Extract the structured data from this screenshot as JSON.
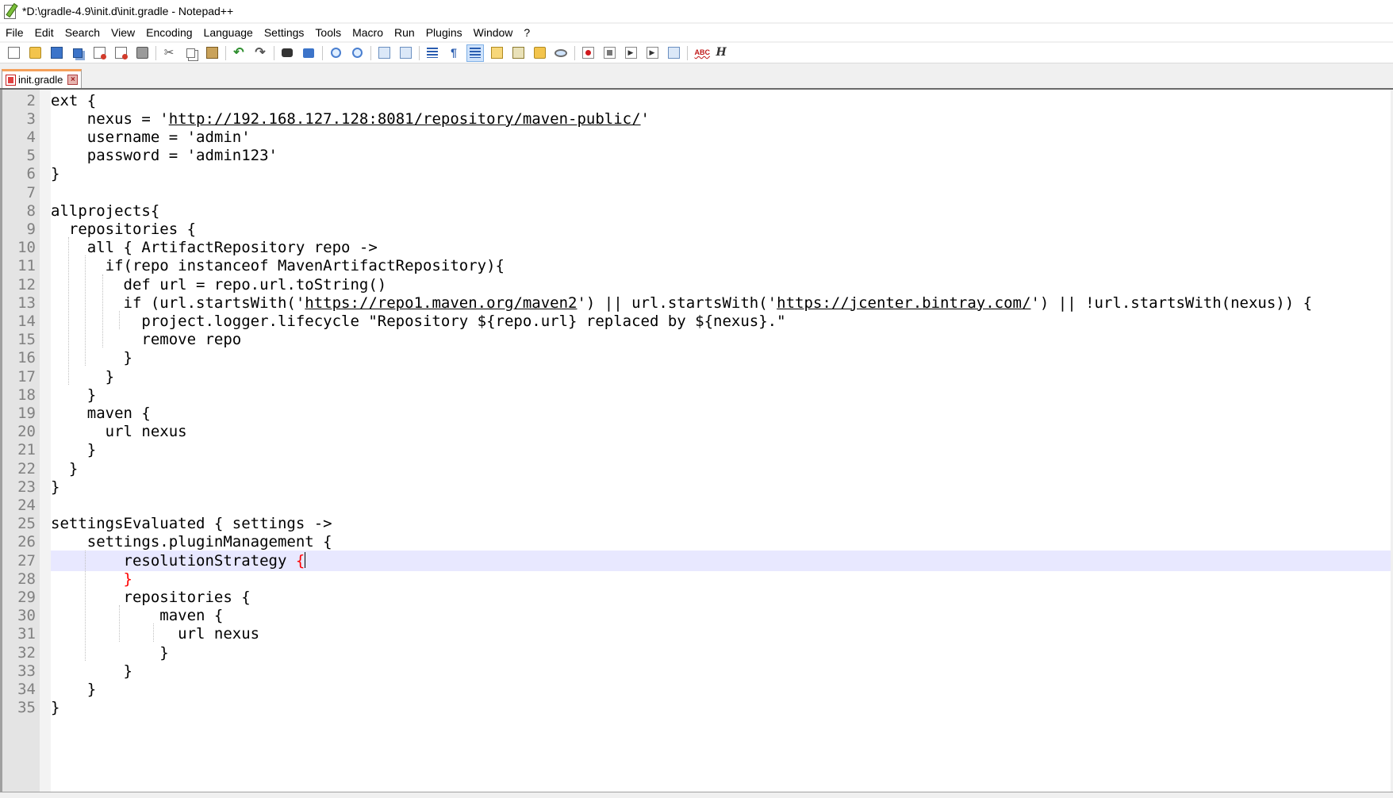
{
  "window": {
    "title": "*D:\\gradle-4.9\\init.d\\init.gradle - Notepad++"
  },
  "menu": [
    {
      "label": "File"
    },
    {
      "label": "Edit"
    },
    {
      "label": "Search"
    },
    {
      "label": "View"
    },
    {
      "label": "Encoding"
    },
    {
      "label": "Language"
    },
    {
      "label": "Settings"
    },
    {
      "label": "Tools"
    },
    {
      "label": "Macro"
    },
    {
      "label": "Run"
    },
    {
      "label": "Plugins"
    },
    {
      "label": "Window"
    },
    {
      "label": "?"
    }
  ],
  "toolbar": {
    "icons": [
      "new-file-icon",
      "open-file-icon",
      "save-icon",
      "save-all-icon",
      "close-icon",
      "close-all-icon",
      "print-icon",
      "cut-icon",
      "copy-icon",
      "paste-icon",
      "undo-icon",
      "redo-icon",
      "find-icon",
      "replace-icon",
      "zoom-in-icon",
      "zoom-out-icon",
      "sync-vertical-icon",
      "sync-horizontal-icon",
      "word-wrap-icon",
      "show-all-chars-icon",
      "indent-guide-icon",
      "document-map-icon",
      "function-list-icon",
      "folder-workspace-icon",
      "monitoring-icon",
      "record-macro-icon",
      "stop-recording-icon",
      "playback-macro-icon",
      "run-macro-multiple-icon",
      "save-macro-icon",
      "spell-check-icon",
      "hex-editor-icon"
    ]
  },
  "tabs": [
    {
      "label": "init.gradle",
      "active": true,
      "modified": true
    }
  ],
  "editor": {
    "current_line": 27,
    "lines": [
      {
        "num": "2",
        "text": "ext {"
      },
      {
        "num": "3",
        "pre": "    nexus = '",
        "url": "http://192.168.127.128:8081/repository/maven-public/",
        "post": "'"
      },
      {
        "num": "4",
        "text": "    username = 'admin'"
      },
      {
        "num": "5",
        "text": "    password = 'admin123'"
      },
      {
        "num": "6",
        "text": "}"
      },
      {
        "num": "7",
        "text": ""
      },
      {
        "num": "8",
        "text": "allprojects{"
      },
      {
        "num": "9",
        "text": "  repositories {"
      },
      {
        "num": "10",
        "text": "    all { ArtifactRepository repo ->"
      },
      {
        "num": "11",
        "text": "      if(repo instanceof MavenArtifactRepository){"
      },
      {
        "num": "12",
        "text": "        def url = repo.url.toString()"
      },
      {
        "num": "13",
        "pre": "        if (url.startsWith('",
        "url": "https://repo1.maven.org/maven2",
        "mid": "') || url.startsWith('",
        "url2": "https://jcenter.bintray.com/",
        "post": "') || !url.startsWith(nexus)) {"
      },
      {
        "num": "14",
        "text": "          project.logger.lifecycle \"Repository ${repo.url} replaced by ${nexus}.\""
      },
      {
        "num": "15",
        "text": "          remove repo"
      },
      {
        "num": "16",
        "text": "        }"
      },
      {
        "num": "17",
        "text": "      }"
      },
      {
        "num": "18",
        "text": "    }"
      },
      {
        "num": "19",
        "text": "    maven {"
      },
      {
        "num": "20",
        "text": "      url nexus"
      },
      {
        "num": "21",
        "text": "    }"
      },
      {
        "num": "22",
        "text": "  }"
      },
      {
        "num": "23",
        "text": "}"
      },
      {
        "num": "24",
        "text": ""
      },
      {
        "num": "25",
        "text": "settingsEvaluated { settings ->"
      },
      {
        "num": "26",
        "text": "    settings.pluginManagement {"
      },
      {
        "num": "27",
        "pre": "        resolutionStrategy ",
        "brace": "{",
        "caret": true
      },
      {
        "num": "28",
        "pre": "        ",
        "brace": "}"
      },
      {
        "num": "29",
        "text": "        repositories {"
      },
      {
        "num": "30",
        "text": "            maven {"
      },
      {
        "num": "31",
        "text": "              url nexus"
      },
      {
        "num": "32",
        "text": "            }"
      },
      {
        "num": "33",
        "text": "        }"
      },
      {
        "num": "34",
        "text": "    }"
      },
      {
        "num": "35",
        "text": "}"
      }
    ]
  },
  "colors": {
    "current_line_bg": "#e8e8ff",
    "brace_match": "#ff0000",
    "line_number": "#808080",
    "gutter_bg": "#e4e4e4"
  }
}
